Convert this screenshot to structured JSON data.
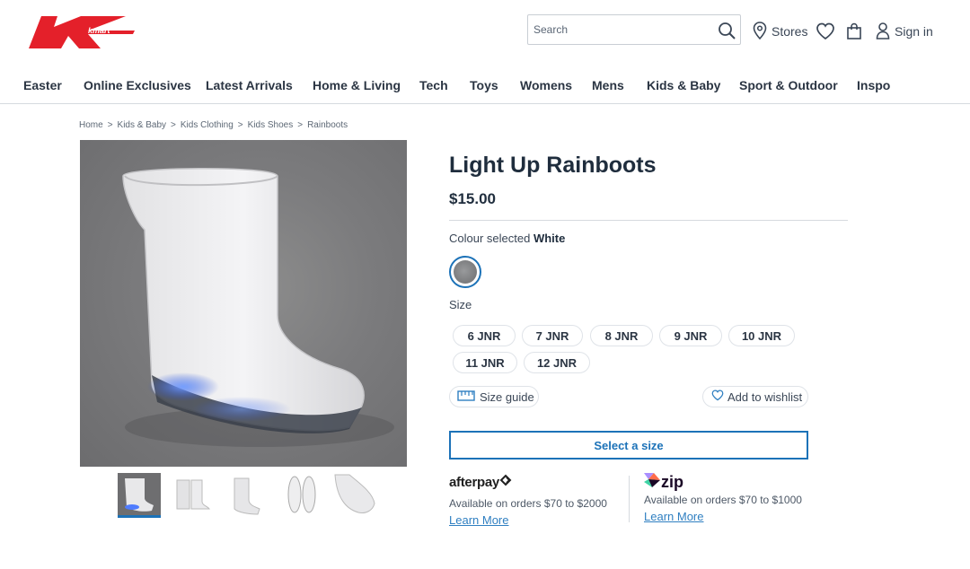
{
  "header": {
    "logo_text": "kmart",
    "search_placeholder": "Search",
    "stores_label": "Stores",
    "signin_label": "Sign in"
  },
  "nav": {
    "items": [
      "Easter",
      "Online Exclusives",
      "Latest Arrivals",
      "Home & Living",
      "Tech",
      "Toys",
      "Womens",
      "Mens",
      "Kids & Baby",
      "Sport & Outdoor",
      "Inspo"
    ]
  },
  "breadcrumb": {
    "items": [
      "Home",
      "Kids & Baby",
      "Kids Clothing",
      "Kids Shoes",
      "Rainboots"
    ],
    "separator": ">"
  },
  "product": {
    "title": "Light Up Rainboots",
    "price": "$15.00",
    "colour_prefix": "Colour selected",
    "colour_value": "White",
    "size_label": "Size",
    "sizes": [
      "6 JNR",
      "7 JNR",
      "8 JNR",
      "9 JNR",
      "10 JNR",
      "11 JNR",
      "12 JNR"
    ],
    "size_guide_label": "Size guide",
    "wishlist_label": "Add to wishlist",
    "select_size_label": "Select a size"
  },
  "payments": {
    "afterpay": {
      "logo": "afterpay",
      "text": "Available on orders $70 to $2000",
      "link": "Learn More"
    },
    "zip": {
      "logo": "zip",
      "text": "Available on orders $70 to $1000",
      "link": "Learn More"
    }
  },
  "colors": {
    "brand_red": "#e4202a",
    "accent_blue": "#1c72b8",
    "link_blue": "#2f7fc1",
    "text_dark": "#1f2d3d"
  },
  "icons": [
    "kmart-logo",
    "search-icon",
    "map-pin-icon",
    "heart-icon",
    "bag-icon",
    "user-icon",
    "ruler-icon",
    "afterpay-arrows-icon",
    "zip-icon"
  ]
}
